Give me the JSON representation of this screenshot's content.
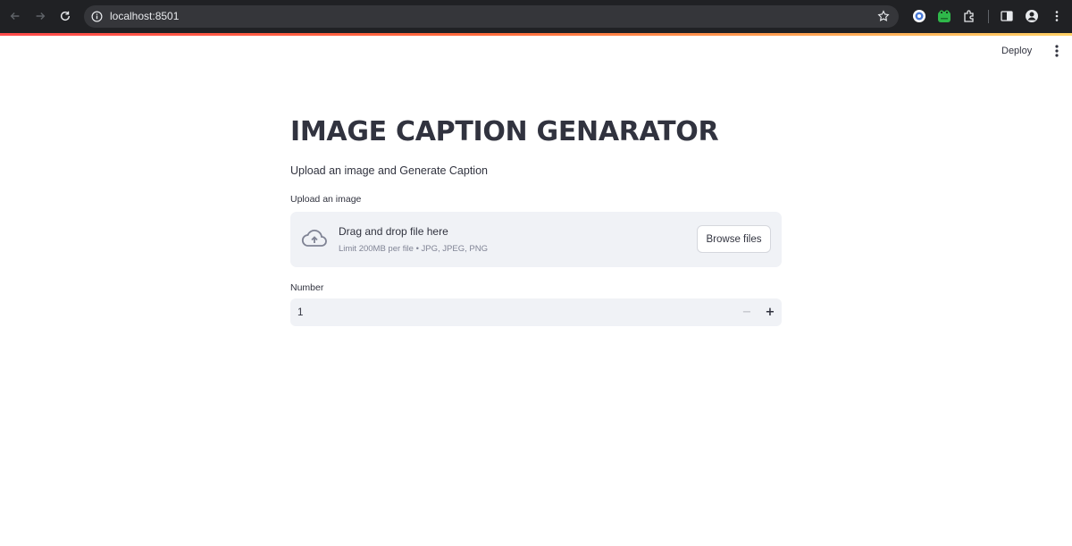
{
  "browser": {
    "url": "localhost:8501",
    "icons": [
      "back-arrow-icon",
      "forward-arrow-icon",
      "reload-icon",
      "info-icon",
      "star-icon",
      "extension-icons",
      "puzzle-icon",
      "sidepanel-icon",
      "profile-icon",
      "menu-icon"
    ]
  },
  "header": {
    "deploy_label": "Deploy"
  },
  "main": {
    "title": "IMAGE CAPTION GENARATOR",
    "subtitle": "Upload an image and Generate Caption",
    "uploader": {
      "label": "Upload an image",
      "drop_text": "Drag and drop file here",
      "limit_text": "Limit 200MB per file • JPG, JPEG, PNG",
      "browse_label": "Browse files"
    },
    "number": {
      "label": "Number",
      "value": "1",
      "minus": "−",
      "plus": "+"
    }
  },
  "colors": {
    "accent_start": "#ff4b4b",
    "accent_end": "#ffd166",
    "text": "#31333f",
    "input_bg": "#f0f2f6"
  }
}
